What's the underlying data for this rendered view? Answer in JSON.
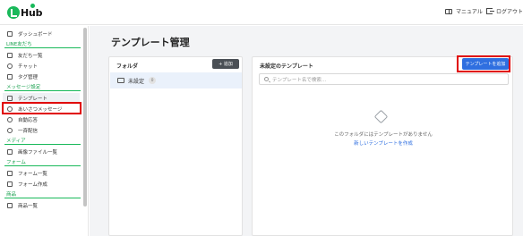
{
  "header": {
    "logo_text": "Hub",
    "manual_label": "マニュアル",
    "logout_label": "ログアウト"
  },
  "sidebar": {
    "items": [
      {
        "kind": "item",
        "label": "ダッシュボード",
        "icon": "home-icon"
      },
      {
        "kind": "section",
        "label": "LINE友だち"
      },
      {
        "kind": "item",
        "label": "友だち一覧",
        "icon": "user-list-icon"
      },
      {
        "kind": "item",
        "label": "チャット",
        "icon": "chat-icon"
      },
      {
        "kind": "item",
        "label": "タグ管理",
        "icon": "tag-icon"
      },
      {
        "kind": "section",
        "label": "メッセージ設定"
      },
      {
        "kind": "item",
        "label": "テンプレート",
        "icon": "template-icon",
        "active": true
      },
      {
        "kind": "item",
        "label": "あいさつメッセージ",
        "icon": "greeting-icon"
      },
      {
        "kind": "item",
        "label": "自動応答",
        "icon": "auto-reply-icon"
      },
      {
        "kind": "item",
        "label": "一斉配信",
        "icon": "broadcast-icon"
      },
      {
        "kind": "section",
        "label": "メディア"
      },
      {
        "kind": "item",
        "label": "画像ファイル一覧",
        "icon": "image-icon"
      },
      {
        "kind": "section",
        "label": "フォーム"
      },
      {
        "kind": "item",
        "label": "フォーム一覧",
        "icon": "form-list-icon"
      },
      {
        "kind": "item",
        "label": "フォーム作成",
        "icon": "plus-icon"
      },
      {
        "kind": "section",
        "label": "商品"
      },
      {
        "kind": "item",
        "label": "商品一覧",
        "icon": "product-icon"
      }
    ]
  },
  "main": {
    "page_title": "テンプレート管理",
    "folder_panel": {
      "title": "フォルダ",
      "add_button": "+ 追加",
      "folders": [
        {
          "name": "未設定",
          "count": "0"
        }
      ]
    },
    "template_panel": {
      "title": "未設定のテンプレート",
      "add_button": "テンプレートを追加",
      "search_placeholder": "テンプレート名で検索...",
      "empty_message": "このフォルダにはテンプレートがありません",
      "create_link": "新しいテンプレートを作成"
    }
  },
  "colors": {
    "brand_green": "#19b95a",
    "primary_blue": "#2f6fe0",
    "highlight_red": "#e00000"
  }
}
